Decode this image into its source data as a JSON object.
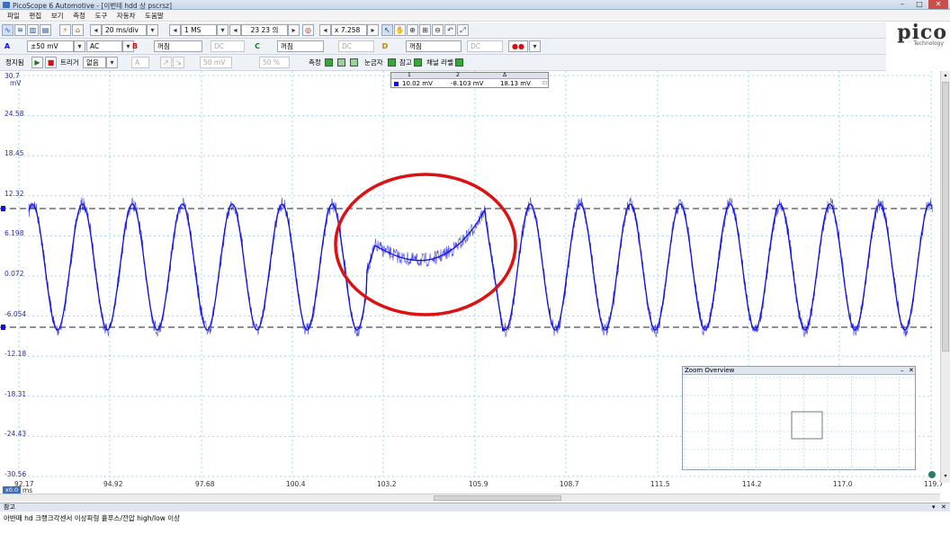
{
  "window": {
    "title": "PicoScope 6 Automotive - [이번테 hdd 상 pscrsz]",
    "min": "–",
    "max": "□",
    "close": "✕"
  },
  "menu": [
    "파일",
    "편집",
    "보기",
    "측정",
    "도구",
    "자동차",
    "도움말"
  ],
  "logo": {
    "brand": "pico",
    "sub": "Technology"
  },
  "toolbar1": {
    "timebase": "20 ms/div",
    "samples": "1 MS",
    "captures": "23 23 의",
    "zoom": "x 7.258"
  },
  "toolbar2": {
    "chA": {
      "label": "A",
      "range": "±50 mV",
      "coupling": "AC"
    },
    "chB": {
      "label": "B",
      "state": "꺼짐",
      "coupling": "DC"
    },
    "chC": {
      "label": "C",
      "state": "꺼짐",
      "coupling": "DC"
    },
    "chD": {
      "label": "D",
      "state": "꺼짐",
      "coupling": "DC"
    }
  },
  "toolbar3": {
    "stop_label": "정지됨",
    "trigger_label": "트리거",
    "trigger_mode": "없음",
    "trigger_source": "A",
    "trigger_level": "50 mV",
    "trigger_pos": "50 %",
    "measure_label": "측정",
    "ruler_label": "눈금자",
    "notes_label": "참고",
    "channel_label": "채널 라벨"
  },
  "scope": {
    "y_unit": "mV",
    "y_ticks": [
      "30.7",
      "24.58",
      "18.45",
      "12.32",
      "6.198",
      "0.072",
      "-6.054",
      "-12.18",
      "-18.31",
      "-24.43",
      "-30.56"
    ],
    "x_unit": "ms",
    "x_ticks": [
      "92.17",
      "94.92",
      "97.68",
      "100.4",
      "103.2",
      "105.9",
      "108.7",
      "111.5",
      "114.2",
      "117.0",
      "119.7"
    ],
    "x_offset_badge": "x0.0"
  },
  "ruler_table": {
    "h1": "1",
    "h2": "2",
    "h3": "Δ",
    "v1": "10.02 mV",
    "v2": "-8.103 mV",
    "v3": "18.13 mV"
  },
  "zoom_overview": {
    "title": "Zoom Overview"
  },
  "notes": {
    "header": "참고",
    "text": "아반떼 hd 크랭크각센서 이상파형 흩푸스/전압 high/low 이상"
  },
  "colors": {
    "trace": "#1010e0",
    "annotation": "#dd1111",
    "axis_text": "#2a2aa8"
  }
}
